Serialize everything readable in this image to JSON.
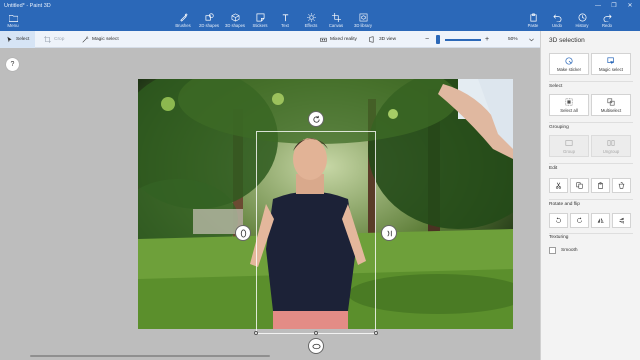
{
  "window": {
    "title": "Untitled* - Paint 3D",
    "controls": [
      "—",
      "❐",
      "✕"
    ]
  },
  "ribbon": {
    "menu_label": "Menu",
    "tools": [
      {
        "label": "Brushes",
        "icon": "brush-icon"
      },
      {
        "label": "2D shapes",
        "icon": "2d-shapes-icon"
      },
      {
        "label": "3D shapes",
        "icon": "3d-shapes-icon"
      },
      {
        "label": "Stickers",
        "icon": "stickers-icon"
      },
      {
        "label": "Text",
        "icon": "text-icon"
      },
      {
        "label": "Effects",
        "icon": "effects-icon"
      },
      {
        "label": "Canvas",
        "icon": "canvas-icon"
      },
      {
        "label": "3D library",
        "icon": "3d-library-icon"
      }
    ],
    "right_tools": [
      {
        "label": "Paste",
        "icon": "paste-icon"
      },
      {
        "label": "Undo",
        "icon": "undo-icon"
      },
      {
        "label": "History",
        "icon": "history-icon"
      },
      {
        "label": "Redo",
        "icon": "redo-icon"
      }
    ]
  },
  "toolbar": {
    "select": "Select",
    "crop": "Crop",
    "magic_select": "Magic select",
    "mixed_reality": "Mixed reality",
    "view_3d": "3D view",
    "zoom_out": "−",
    "zoom_in": "+",
    "zoom_level": "50%",
    "zoom_fraction": 0.5
  },
  "panel": {
    "title": "3D selection",
    "make_sticker": "Make sticker",
    "magic_select": "Magic select",
    "select_section": "Select",
    "select_all": "Select all",
    "multiselect": "Multiselect",
    "grouping_section": "Grouping",
    "group": "Group",
    "ungroup": "Ungroup",
    "edit_section": "Edit",
    "rotate_section": "Rotate and flip",
    "texturing_section": "Texturing",
    "smooth": "Smooth"
  },
  "canvas": {
    "help": "?"
  },
  "colors": {
    "ribbon": "#2b68b8",
    "toolbar": "#eef3fa",
    "panel": "#f3f3f3",
    "canvas_bg": "#bdbdbd"
  }
}
